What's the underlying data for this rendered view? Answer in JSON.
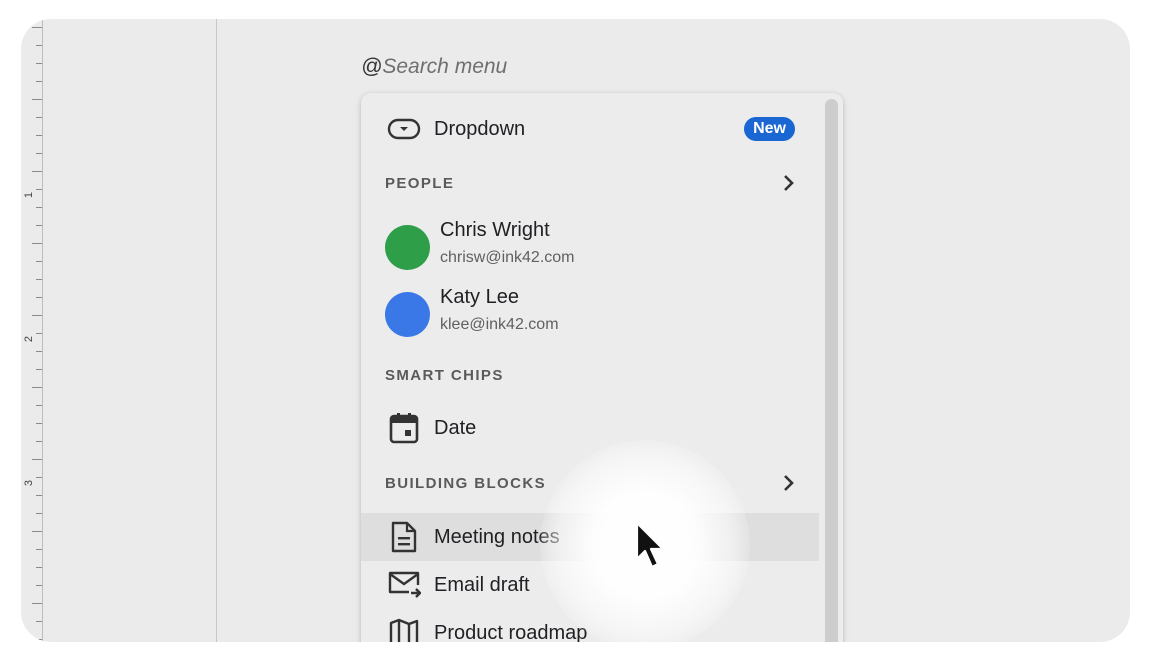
{
  "search": {
    "at_symbol": "@",
    "placeholder": "Search menu"
  },
  "ruler": {
    "numbers": [
      "1",
      "2",
      "3"
    ]
  },
  "menu": {
    "dropdown": {
      "label": "Dropdown",
      "badge": "New",
      "icon": "dropdown-chip-icon"
    },
    "people": {
      "title": "PEOPLE",
      "items": [
        {
          "name": "Chris Wright",
          "email": "chrisw@ink42.com",
          "color": "#2f9e48"
        },
        {
          "name": "Katy Lee",
          "email": "klee@ink42.com",
          "color": "#3b78e7"
        }
      ]
    },
    "smart_chips": {
      "title": "SMART CHIPS",
      "items": [
        {
          "label": "Date",
          "icon": "calendar-icon"
        }
      ]
    },
    "building_blocks": {
      "title": "BUILDING BLOCKS",
      "items": [
        {
          "label": "Meeting notes",
          "icon": "document-icon"
        },
        {
          "label": "Email draft",
          "icon": "email-draft-icon"
        },
        {
          "label": "Product roadmap",
          "icon": "map-icon"
        }
      ]
    }
  },
  "colors": {
    "badge": "#1a66d2",
    "accent": "#1a66d2"
  }
}
